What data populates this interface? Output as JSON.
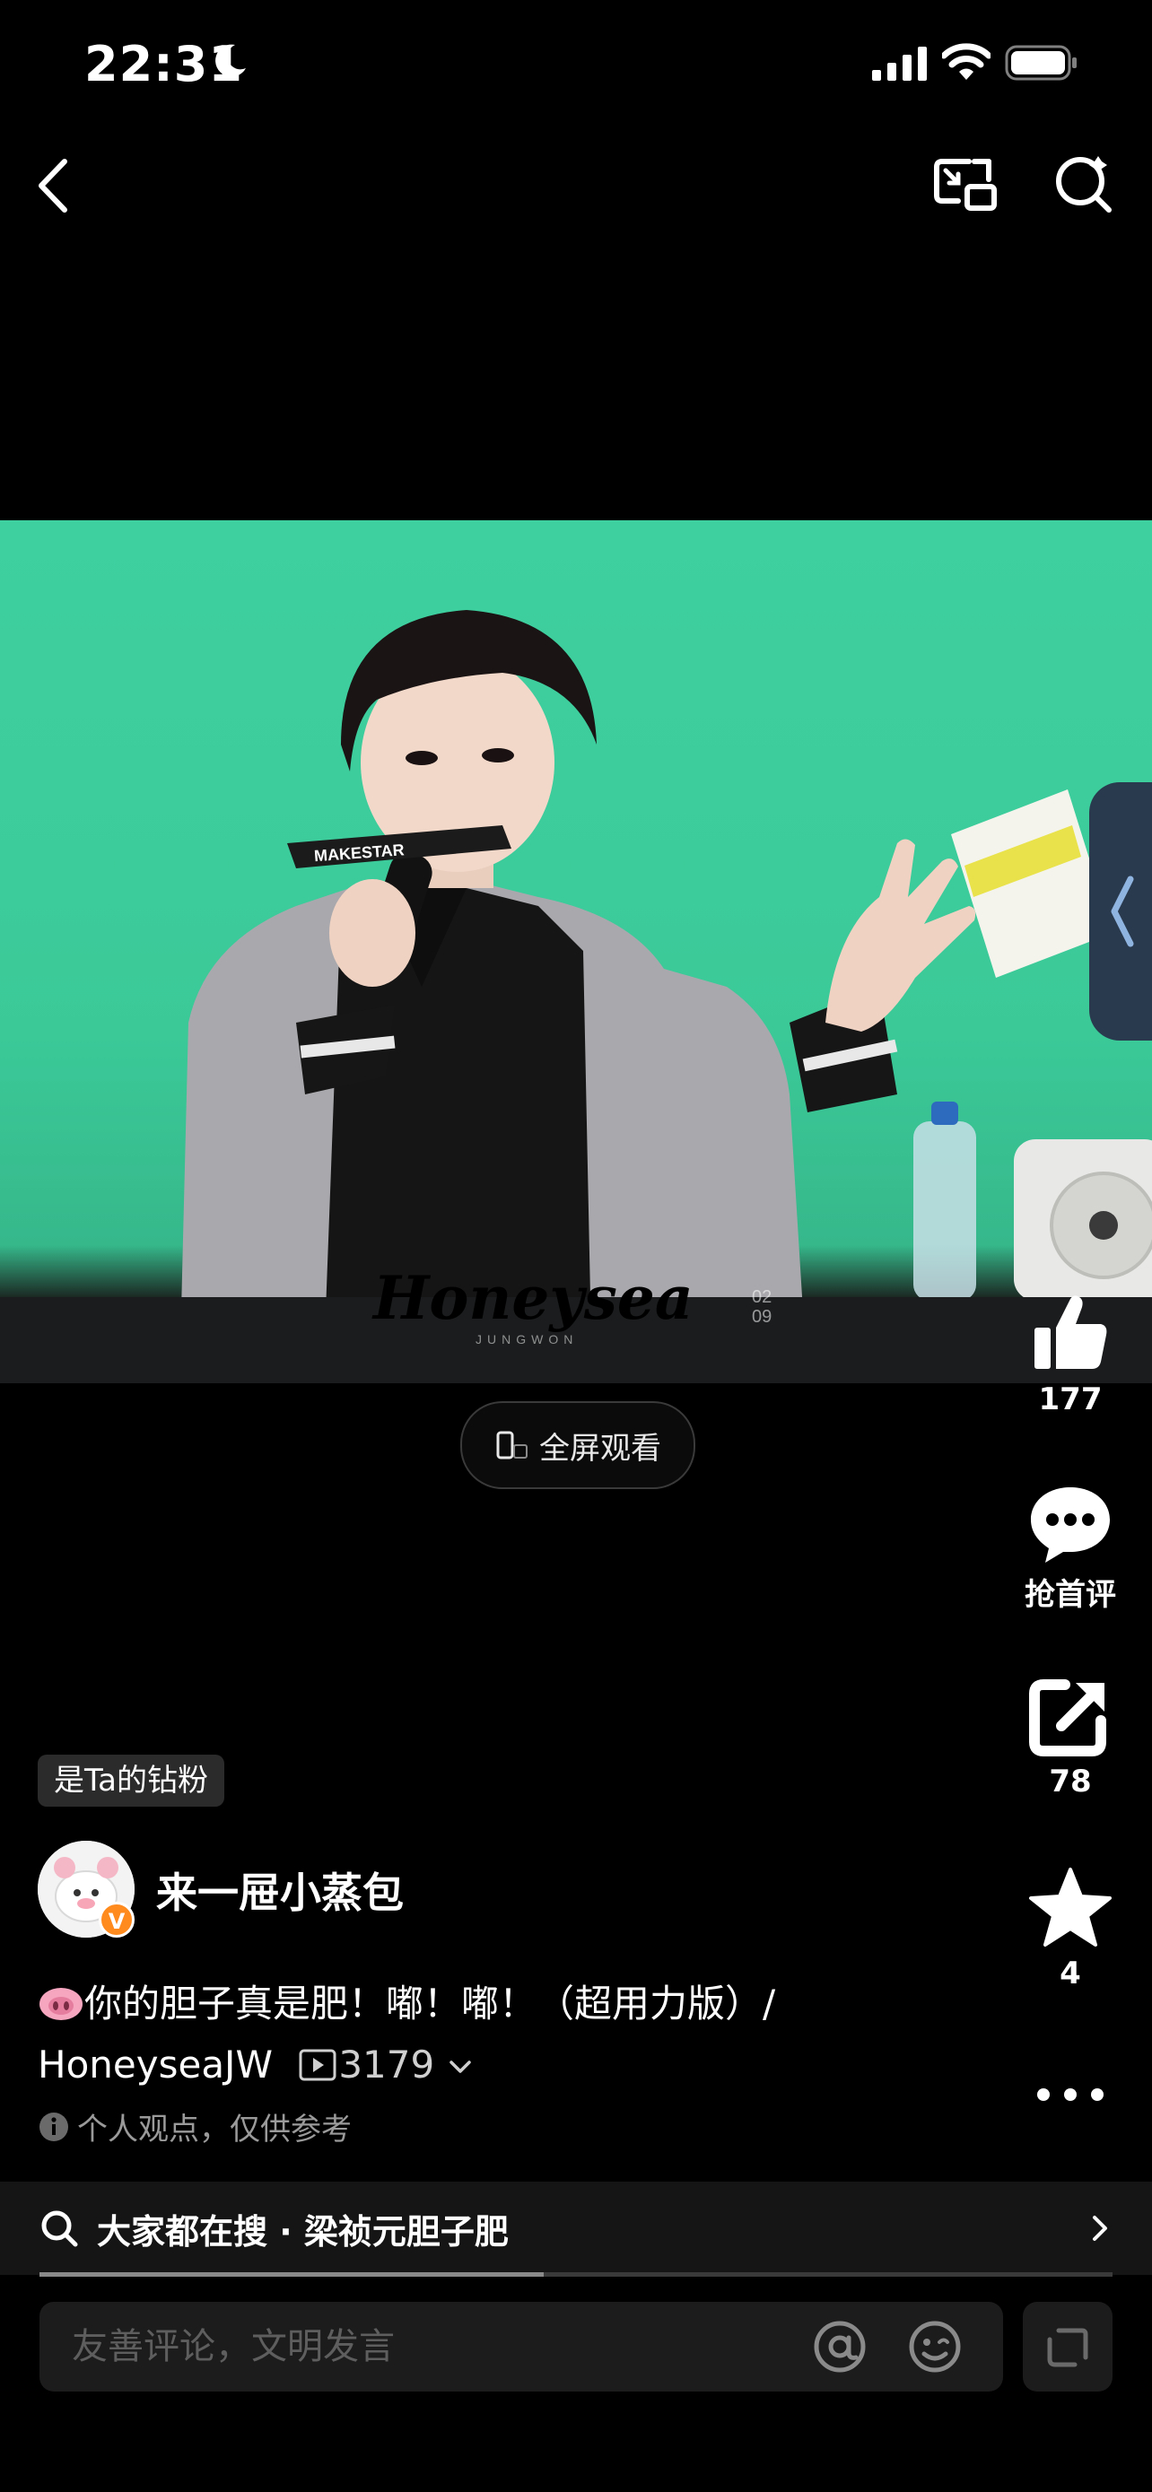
{
  "status_bar": {
    "time": "22:31"
  },
  "video": {
    "watermark": "Honeysea",
    "watermark_sub": "JUNGWON",
    "watermark_date": "02\n09",
    "mic_brand": "MAKESTAR"
  },
  "fullscreen_button": {
    "label": "全屏观看"
  },
  "actions": {
    "like": {
      "count": "177"
    },
    "comment": {
      "label": "抢首评"
    },
    "share": {
      "count": "78"
    },
    "favorite": {
      "count": "4"
    }
  },
  "fan_badge": "是Ta的钻粉",
  "author": {
    "name": "来一屉小蒸包"
  },
  "caption": {
    "text": "你的胆子真是肥！嘟！嘟！（超用力版）/ HoneyseaJW",
    "collection_count": "3179"
  },
  "disclaimer": "个人观点，仅供参考",
  "related_search": {
    "text": "大家都在搜 · 梁祯元胆子肥"
  },
  "progress": 0.47,
  "comment_input": {
    "placeholder": "友善评论，文明发言"
  },
  "colors": {
    "video_bg": "#3fd0a0",
    "side_tab": "#2a3a4e",
    "vip_badge": "#ff8a1e"
  }
}
